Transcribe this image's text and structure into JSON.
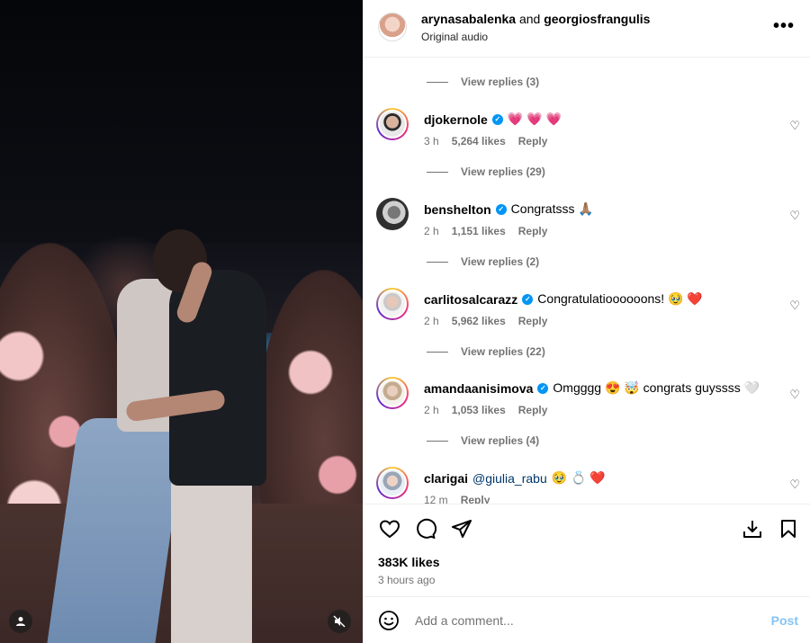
{
  "header": {
    "user1": "arynasabalenka",
    "joiner": "and",
    "user2": "georgiosfrangulis",
    "subtitle": "Original audio",
    "more_icon": "more-horizontal-icon"
  },
  "view_replies": [
    "View replies (3)",
    "View replies (29)",
    "View replies (2)",
    "View replies (22)",
    "View replies (4)"
  ],
  "comments": [
    {
      "user": "djokernole",
      "text": "💗 💗 💗",
      "time": "3 h",
      "likes": "5,264 likes",
      "reply": "Reply"
    },
    {
      "user": "benshelton",
      "text": "Congratsss 🙏🏽",
      "time": "2 h",
      "likes": "1,151 likes",
      "reply": "Reply"
    },
    {
      "user": "carlitosalcarazz",
      "text": "Congratulatioooooons! 🥹 ❤️",
      "time": "2 h",
      "likes": "5,962 likes",
      "reply": "Reply"
    },
    {
      "user": "amandaanisimova",
      "text": "Omgggg 😍 🤯 congrats guyssss 🤍",
      "time": "2 h",
      "likes": "1,053 likes",
      "reply": "Reply"
    },
    {
      "user": "clarigai",
      "mention": "@giulia_rabu",
      "text": "🥹 💍 ❤️",
      "time": "12 m",
      "reply": "Reply"
    }
  ],
  "actions": {
    "likes": "383K likes",
    "time_ago": "3 hours ago"
  },
  "add_comment": {
    "placeholder": "Add a comment...",
    "post": "Post"
  },
  "colors": {
    "verified": "#0095f6",
    "post_disabled": "#84c3f5",
    "heart": "#ee1d52"
  }
}
